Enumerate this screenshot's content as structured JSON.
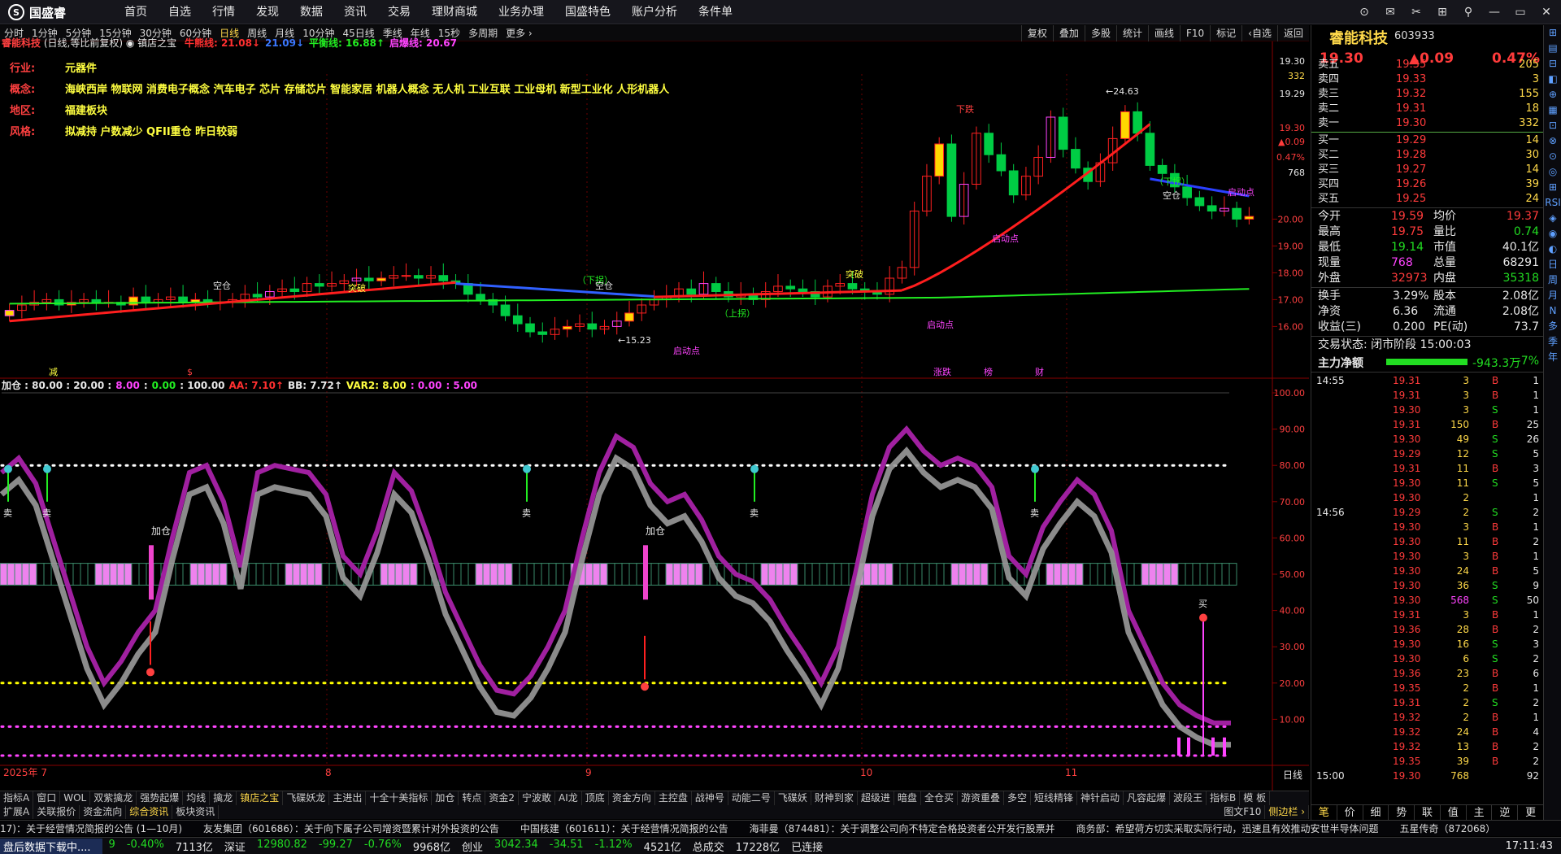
{
  "app": {
    "logo_text": "国盛睿",
    "menu": [
      "首页",
      "自选",
      "行情",
      "发现",
      "数据",
      "资讯",
      "交易",
      "理财商城",
      "业务办理",
      "国盛特色",
      "账户分析",
      "条件单"
    ],
    "window_controls": [
      "⊙",
      "✉",
      "✂",
      "⊞",
      "⚲",
      "—",
      "▭",
      "✕"
    ]
  },
  "periods": [
    "分时",
    "1分钟",
    "5分钟",
    "15分钟",
    "30分钟",
    "60分钟",
    "日线",
    "周线",
    "月线",
    "10分钟",
    "45日线",
    "季线",
    "年线",
    "15秒",
    "多周期",
    "更多 ›"
  ],
  "active_period": "日线",
  "chart_tools": [
    "复权",
    "叠加",
    "多股",
    "统计",
    "画线",
    "F10",
    "标记",
    "‹自选",
    "返回"
  ],
  "chart_header": {
    "stock": "睿能科技",
    "mode": "(日线,等比前复权)",
    "indicator": "◉ 镇店之宝",
    "lines": [
      {
        "label": "牛熊线: 21.08↓",
        "color": "#ff3030"
      },
      {
        "label": "21.09↓",
        "color": "#3a78ff"
      },
      {
        "label": "平衡线: 16.88↑",
        "color": "#22ee22"
      },
      {
        "label": "启爆线: 20.67",
        "color": "#ff44ff"
      }
    ]
  },
  "profile": [
    {
      "key": "行业:",
      "value": "元器件"
    },
    {
      "key": "概念:",
      "value": "海峡西岸 物联网 消费电子概念 汽车电子 芯片 存储芯片 智能家居 机器人概念 无人机 工业互联 工业母机 新型工业化 人形机器人"
    },
    {
      "key": "地区:",
      "value": "福建板块"
    },
    {
      "key": "风格:",
      "value": "拟减持 户数减少 QFII重仓 昨日较弱"
    }
  ],
  "price_axis": [
    "19.30",
    "332",
    "19.29",
    "19.30",
    "0.09",
    "0.47%",
    "768",
    "20.00",
    "19.00",
    "18.00",
    "17.00",
    "16.00"
  ],
  "price_ticks": [
    "20.00",
    "19.00",
    "18.00",
    "17.00",
    "16.00"
  ],
  "osc_header": [
    {
      "text": "加仓 : 80.00 : 20.00 :",
      "color": "#e8e8e8"
    },
    {
      "text": "8.00",
      "color": "#ff44ff"
    },
    {
      "text": ":",
      "color": "#e8e8e8"
    },
    {
      "text": "0.00",
      "color": "#22ee22"
    },
    {
      "text": ": 100.00",
      "color": "#e8e8e8"
    },
    {
      "text": "AA: 7.10↑",
      "color": "#ff3030"
    },
    {
      "text": "BB: 7.72↑",
      "color": "#e8e8e8"
    },
    {
      "text": "VAR2: 8.00",
      "color": "#ffff40"
    },
    {
      "text": ": 0.00",
      "color": "#ff44ff"
    },
    {
      "text": ": 5.00",
      "color": "#ff44ff"
    }
  ],
  "osc_axis": [
    "100.00",
    "90.00",
    "80.00",
    "70.00",
    "60.00",
    "50.00",
    "40.00",
    "30.00",
    "20.00",
    "10.00"
  ],
  "date_axis": [
    {
      "label": "2025年 7",
      "x": 0
    },
    {
      "label": "8",
      "x": 0
    },
    {
      "label": "9",
      "x": 0
    },
    {
      "label": "10",
      "x": 0
    },
    {
      "label": "11",
      "x": 0
    }
  ],
  "period_label": "日线",
  "chart_annotations": {
    "high": "←24.63",
    "low1": "←15.23",
    "start": "启动点",
    "buy": "买",
    "sell": "卖",
    "add": "加仓",
    "empty": "空仓",
    "downturn": "（下拐）",
    "upturn": "（上拐）",
    "break": "突破",
    "limit_up": "下跌",
    "events": [
      "减",
      "$",
      "涨跌",
      "榜",
      "财"
    ]
  },
  "tabs1": [
    "指标A",
    "窗口",
    "WOL",
    "双紫擒龙",
    "强势起爆",
    "均线",
    "擒龙",
    "镇店之宝",
    "飞碟妖龙",
    "主进出",
    "十全十美指标",
    "加仓",
    "转点",
    "资金2",
    "宁波敢",
    "AI龙",
    "顶底",
    "资金方向",
    "主控盘",
    "战神号",
    "动能二号",
    "飞碟妖",
    "财神到家",
    "超级进",
    "暗盘",
    "全仓买",
    "游资重叠",
    "多空",
    "短线精锋",
    "神针启动",
    "凡容起爆",
    "波段王",
    "指标B",
    "模 板"
  ],
  "tabs1_active": "镇店之宝",
  "tabs2": [
    "扩展A",
    "关联报价",
    "资金流向",
    "综合资讯",
    "板块资讯"
  ],
  "tabs2_active": "综合资讯",
  "tabs2_right": [
    "图文F10",
    "侧边栏 ›"
  ],
  "news": [
    "17)：关于经营情况简报的公告 (1—10月)",
    "友发集团（601686）：关于向下属子公司增资暨累计对外投资的公告",
    "中国核建（601611）：关于经营情况简报的公告",
    "海菲曼（874481）：关于调整公司向不特定合格投资者公开发行股票并",
    "商务部：希望荷方切实采取实际行动，迅速且有效推动安世半导体问题",
    "五星传奇（872068）"
  ],
  "status": {
    "left": "盘后数据下载中....",
    "items": [
      {
        "t": "9",
        "c": "g"
      },
      {
        "t": "-0.40%",
        "c": "g"
      },
      {
        "t": "7113亿",
        "c": "w"
      },
      {
        "t": "深证",
        "c": "w"
      },
      {
        "t": "12980.82",
        "c": "g"
      },
      {
        "t": "-99.27",
        "c": "g"
      },
      {
        "t": "-0.76%",
        "c": "g"
      },
      {
        "t": "9968亿",
        "c": "w"
      },
      {
        "t": "创业",
        "c": "w"
      },
      {
        "t": "3042.34",
        "c": "g"
      },
      {
        "t": "-34.51",
        "c": "g"
      },
      {
        "t": "-1.12%",
        "c": "g"
      },
      {
        "t": "4521亿",
        "c": "w"
      },
      {
        "t": "总成交",
        "c": "w"
      },
      {
        "t": "17228亿",
        "c": "w"
      },
      {
        "t": "已连接",
        "c": "w"
      }
    ],
    "time": "17:11:43"
  },
  "quote": {
    "name": "睿能科技",
    "code": "603933",
    "price": "19.30",
    "change": "▲0.09",
    "pct": "0.47%",
    "asks": [
      {
        "label": "卖五",
        "price": "19.35",
        "vol": "205"
      },
      {
        "label": "卖四",
        "price": "19.33",
        "vol": "3"
      },
      {
        "label": "卖三",
        "price": "19.32",
        "vol": "155"
      },
      {
        "label": "卖二",
        "price": "19.31",
        "vol": "18"
      },
      {
        "label": "卖一",
        "price": "19.30",
        "vol": "332"
      }
    ],
    "bids": [
      {
        "label": "买一",
        "price": "19.29",
        "vol": "14"
      },
      {
        "label": "买二",
        "price": "19.28",
        "vol": "30"
      },
      {
        "label": "买三",
        "price": "19.27",
        "vol": "14"
      },
      {
        "label": "买四",
        "price": "19.26",
        "vol": "39"
      },
      {
        "label": "买五",
        "price": "19.25",
        "vol": "24"
      }
    ],
    "stats": [
      {
        "l": "今开",
        "lv": "19.59",
        "lc": "r",
        "r": "均价",
        "rv": "19.37",
        "rc": "r"
      },
      {
        "l": "最高",
        "lv": "19.75",
        "lc": "r",
        "r": "量比",
        "rv": "0.74",
        "rc": "g"
      },
      {
        "l": "最低",
        "lv": "19.14",
        "lc": "g",
        "r": "市值",
        "rv": "40.1亿",
        "rc": "w"
      },
      {
        "l": "现量",
        "lv": "768",
        "lc": "m",
        "r": "总量",
        "rv": "68291",
        "rc": "w"
      },
      {
        "l": "外盘",
        "lv": "32973",
        "lc": "r",
        "r": "内盘",
        "rv": "35318",
        "rc": "g"
      }
    ],
    "stats2": [
      {
        "l": "换手",
        "lv": "3.29%",
        "r": "股本",
        "rv": "2.08亿"
      },
      {
        "l": "净资",
        "lv": "6.36",
        "r": "流通",
        "rv": "2.08亿"
      },
      {
        "l": "收益(三)",
        "lv": "0.200",
        "r": "PE(动)",
        "rv": "73.7"
      }
    ],
    "trade_status": "交易状态: 闭市阶段 15:00:03",
    "main_flow_label": "主力净额",
    "main_flow_value": "-943.3万",
    "main_flow_pct": "-7%",
    "ticks": [
      {
        "t": "14:55",
        "p": "19.31",
        "v": "3",
        "s": "B",
        "n": "1"
      },
      {
        "t": "",
        "p": "19.31",
        "v": "3",
        "s": "B",
        "n": "1"
      },
      {
        "t": "",
        "p": "19.30",
        "v": "3",
        "s": "S",
        "n": "1"
      },
      {
        "t": "",
        "p": "19.31",
        "v": "150",
        "s": "B",
        "n": "25"
      },
      {
        "t": "",
        "p": "19.30",
        "v": "49",
        "s": "S",
        "n": "26"
      },
      {
        "t": "",
        "p": "19.29",
        "v": "12",
        "s": "S",
        "n": "5"
      },
      {
        "t": "",
        "p": "19.31",
        "v": "11",
        "s": "B",
        "n": "3"
      },
      {
        "t": "",
        "p": "19.30",
        "v": "11",
        "s": "S",
        "n": "5"
      },
      {
        "t": "",
        "p": "19.30",
        "v": "2",
        "s": "",
        "n": "1"
      },
      {
        "t": "14:56",
        "p": "19.29",
        "v": "2",
        "s": "S",
        "n": "2"
      },
      {
        "t": "",
        "p": "19.30",
        "v": "3",
        "s": "B",
        "n": "1"
      },
      {
        "t": "",
        "p": "19.30",
        "v": "11",
        "s": "B",
        "n": "2"
      },
      {
        "t": "",
        "p": "19.30",
        "v": "3",
        "s": "B",
        "n": "1"
      },
      {
        "t": "",
        "p": "19.30",
        "v": "24",
        "s": "B",
        "n": "5"
      },
      {
        "t": "",
        "p": "19.30",
        "v": "36",
        "s": "S",
        "n": "9"
      },
      {
        "t": "",
        "p": "19.30",
        "v": "568",
        "s": "S",
        "n": "50"
      },
      {
        "t": "",
        "p": "19.31",
        "v": "3",
        "s": "B",
        "n": "1"
      },
      {
        "t": "",
        "p": "19.36",
        "v": "28",
        "s": "B",
        "n": "2"
      },
      {
        "t": "",
        "p": "19.30",
        "v": "16",
        "s": "S",
        "n": "3"
      },
      {
        "t": "",
        "p": "19.30",
        "v": "6",
        "s": "S",
        "n": "2"
      },
      {
        "t": "",
        "p": "19.36",
        "v": "23",
        "s": "B",
        "n": "6"
      },
      {
        "t": "",
        "p": "19.35",
        "v": "2",
        "s": "B",
        "n": "1"
      },
      {
        "t": "",
        "p": "19.31",
        "v": "2",
        "s": "S",
        "n": "2"
      },
      {
        "t": "",
        "p": "19.32",
        "v": "2",
        "s": "B",
        "n": "1"
      },
      {
        "t": "",
        "p": "19.32",
        "v": "24",
        "s": "B",
        "n": "4"
      },
      {
        "t": "",
        "p": "19.32",
        "v": "13",
        "s": "B",
        "n": "2"
      },
      {
        "t": "",
        "p": "19.35",
        "v": "39",
        "s": "B",
        "n": "2"
      },
      {
        "t": "15:00",
        "p": "19.30",
        "v": "768",
        "s": "",
        "n": "92"
      }
    ],
    "bottom_tabs": [
      "笔",
      "价",
      "细",
      "势",
      "联",
      "值",
      "主",
      "逆",
      "更"
    ],
    "bottom_tab_active": "笔"
  },
  "vstrip": [
    "⊞",
    "▤",
    "⊟",
    "◧",
    "⊕",
    "▦",
    "⊡",
    "⊗",
    "⊙",
    "◎",
    "⊞",
    "RSI",
    "◈",
    "◉",
    "◐",
    "日",
    "周",
    "月",
    "N",
    "多",
    "季",
    "年"
  ]
}
